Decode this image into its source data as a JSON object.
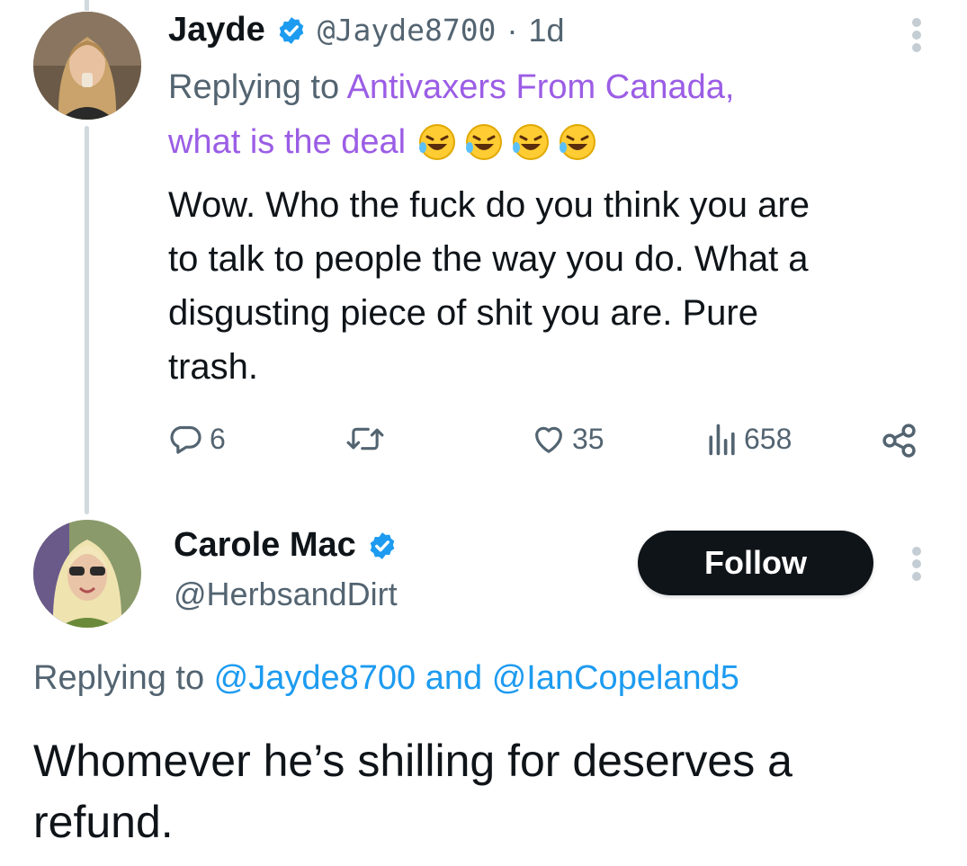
{
  "tweet1": {
    "name": "Jayde",
    "handle": "@Jayde8700",
    "separator": "·",
    "time": "1d",
    "replying_prefix": "Replying to ",
    "replying_to_line1": "Antivaxers From Canada,",
    "replying_to_line2": "what is the deal",
    "replying_emoji": "🤣🤣🤣🤣",
    "body_lines": [
      "Wow. Who the fuck do you think you are",
      "to talk to people the way you do. What a",
      "disgusting piece of shit you are. Pure",
      "trash."
    ],
    "actions": {
      "replies": "6",
      "likes": "35",
      "views": "658"
    }
  },
  "tweet2": {
    "name": "Carole Mac",
    "handle": "@HerbsandDirt",
    "follow_label": "Follow",
    "replying_prefix": "Replying to ",
    "mention1": "@Jayde8700",
    "conjunction": " and ",
    "mention2": "@IanCopeland5",
    "body_lines": [
      "Whomever he’s shilling for deserves a",
      "refund."
    ]
  },
  "colors": {
    "link_blue": "#1d9bf0",
    "community_purple": "#9b5de5",
    "verified_blue": "#1d9bf0",
    "muted": "#536471"
  },
  "icons": [
    "verified-badge-icon",
    "more-options-icon",
    "reply-icon",
    "retweet-icon",
    "like-icon",
    "views-icon",
    "share-icon"
  ]
}
